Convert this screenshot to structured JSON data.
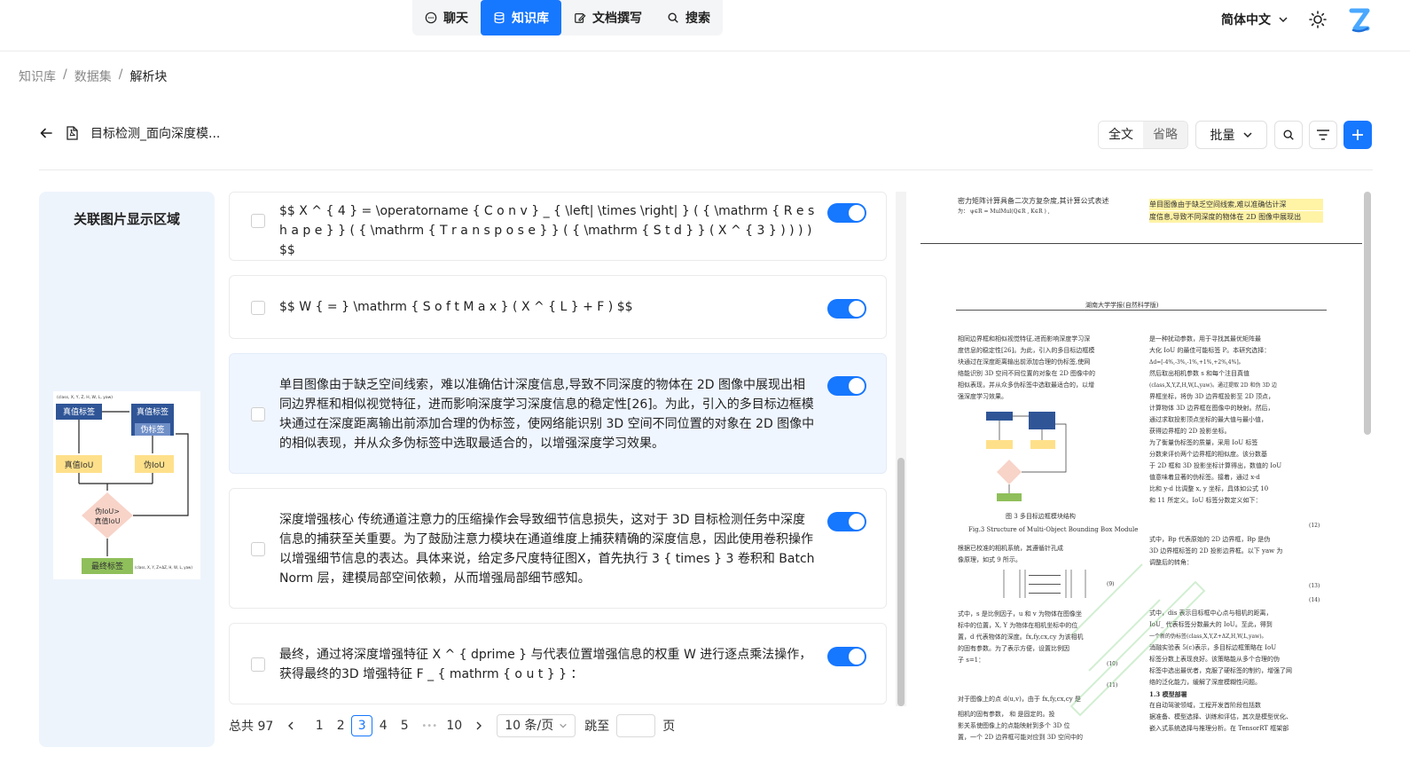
{
  "nav": {
    "items": [
      {
        "label": "聊天",
        "icon": "chat-icon",
        "active": false
      },
      {
        "label": "知识库",
        "icon": "database-icon",
        "active": true
      },
      {
        "label": "文档撰写",
        "icon": "edit-icon",
        "active": false
      },
      {
        "label": "搜索",
        "icon": "search-icon",
        "active": false
      }
    ],
    "language": "简体中文"
  },
  "breadcrumb": [
    "知识库",
    "数据集",
    "解析块"
  ],
  "document": {
    "title": "目标检测_面向深度模..."
  },
  "toolbar": {
    "view_full": "全文",
    "view_brief": "省略",
    "batch": "批量"
  },
  "left_panel": {
    "title": "关联图片显示区域",
    "flow": {
      "top_note": "(class, X, Y, Z, H, W, L, yaw)",
      "n1": "真值标签",
      "n2": "真值标签",
      "n2b": "伪标签",
      "n3": "真值IoU",
      "n4": "伪IoU",
      "n5": "伪IoU>",
      "n5b": "真值IoU",
      "n6": "最终标签",
      "bottom_note": "(class, X, Y, Z+ΔZ, H, W, L, yaw)"
    }
  },
  "chunks": [
    {
      "text": "$$ X ^ { 4 } = \\operatorname { C o n v } _ { \\left| \\times \\right| } ( { \\mathrm { R e s h a p e } } ( { \\mathrm { T r a n s p o s e } } ( { \\mathrm { S t d } } ( X ^ { 3 } ) ) ) ) $$",
      "enabled": true,
      "selected": false
    },
    {
      "text": "$$ W { = } \\mathrm { S o f t M a x } ( X ^ { L } + F ) $$",
      "enabled": true,
      "selected": false
    },
    {
      "text": "单目图像由于缺乏空间线索，难以准确估计深度信息,导致不同深度的物体在 2D 图像中展现出相同边界框和相似视觉特征，进而影响深度学习深度信息的稳定性[26]。为此，引入的多目标边框模块通过在深度距离输出前添加合理的伪标签，使网络能识别 3D 空间不同位置的对象在 2D 图像中的相似表现，并从众多伪标签中选取最适合的，以增强深度学习效果。",
      "enabled": true,
      "selected": true
    },
    {
      "text": "深度增强核心 传统通道注意力的压缩操作会导致细节信息损失，这对于 3D 目标检测任务中深度信息的捕获至关重要。为了鼓励注意力模块在通道维度上捕获精确的深度信息，因此使用卷积操作以增强细节信息的表达。具体来说，给定多尺度特征图X，首先执行 3 { times } 3 卷积和 BatchNorm 层，建模局部空间依赖，从而增强局部细节感知。",
      "enabled": true,
      "selected": false
    },
    {
      "text": "最终，通过将深度增强特征 X ^ { dprime } 与代表位置增强信息的权重 W 进行逐点乘法操作，获得最终的3D 增强特征 F _ { mathrm { o u t } } ：",
      "enabled": true,
      "selected": false
    }
  ],
  "pagination": {
    "total": "总共 97",
    "pages": [
      "1",
      "2",
      "3",
      "4",
      "5",
      "•••",
      "10"
    ],
    "current": "3",
    "page_size": "10 条/页",
    "jump_label": "跳至",
    "page_suffix": "页"
  },
  "pdf": {
    "top_left_1": "密力矩阵计算具备二次方复杂度,其计算公式表述",
    "top_left_2": "为：   ψ∈R = MulMul(Q∈R , K∈R  ) ,",
    "top_right_1": "单目图像由于缺乏空间线索,难以准确估计深",
    "top_right_2": "度信息,导致不同深度的物体在 2D 图像中展现出",
    "journal": "湖南大学学报(自然科学版)",
    "fig_caption_cn": "图 3  多目标边框模块结构",
    "fig_caption_en": "Fig.3  Structure of Multi-Object Bounding Box Module",
    "col1_lines": [
      "相同边界框和相似视觉特征,进而影响深度学习深",
      "度信息的稳定性[26]。为此，引入的多目标边框模",
      "块通过在深度距离输出前添加合理的伪标签,使网",
      "络能识别 3D 空间不同位置的对象在 2D 图像中的",
      "相似表现，并从众多伪标签中选取最适合的，以增",
      "强深度学习效果。"
    ],
    "col1b_lines": [
      "根据已校准的相机系统，其遵循针孔成",
      "像原理，如式 9 所示。",
      "式中，s 是比例因子，u 和 v 为物体在图像坐",
      "标中的位置，X, Y 为物体在相机坐标中的位",
      "置，d 代表物体的深度。fx,fy,cx,cy 为该相机",
      "的固有参数。为了表示方便，设置比例因",
      "子 s=1："
    ],
    "col2_lines": [
      "是一种扰动参数，用于寻找其最优矩阵最",
      "大化 IoU 的最佳可能标签 P。本研究选择：",
      "Δd=[-4%,-3%,-1%,+1%,+2%,4%]。",
      "然后取出相机参数 s 和每个注目真值",
      "(class,X,Y,Z,H,W,L,yaw)。通过提取 2D 和伪 3D 边",
      "界框坐标，将伪 3D 边界框投影至 2D 顶点，",
      "计算物体 3D 边界框在图像中的映射。然后，",
      "通过求取投影顶点坐标的最大值与最小值，",
      "获得边界框的 2D 投影坐标。",
      "为了衡量伪标签的质量，采用 IoU 标签",
      "分数来评价两个边界框的相似度。该分数基",
      "于 2D 框和 3D 投影坐标计算得出，数值的 IoU",
      "值意味着显著的伪标签。接着，通过 x-d",
      "比和 y-d 比调整 x, y 坐标，具体如公式 10",
      "和 11 所定义。IoU 标签分数定义如下："
    ],
    "col2b_lines": [
      "式中，Bp 代表原始的 2D 边界框，Bp 是伪",
      "3D 边界框标签的 2D 投影边界框。以下 yaw 为",
      "调整后的转角：",
      "式中，dis 表示目标框中心点与相机的距离，",
      "IoU_ 代表标签分数最大的 IoU。至此，得到",
      "一个新的伪标签(class,X,Y,Z+ΔZ,H,W,L,yaw)。",
      "消融实验表 5(c)表示，多目标边框策略在 IoU",
      "标签分数上表现良好。该策略能从多个合理的伪",
      "标签中选出最优者，克服了硬标签的制约，增强了网",
      "络的泛化能力，缓解了深度模糊性问题。",
      "1.3  模型部署",
      "在自动驾驶领域，工程开发首阶段包括数",
      "据准备、模型选择、训练和评估，其次是模型优化、",
      "嵌入式系统选择与推理分析。在 TensorRT 框架部"
    ],
    "col1c_lines": [
      "对于图像上的点 d(u,v)，由于 fx,fy,cx,cy 是",
      "相机的固有参数，      和      是固定的。投",
      "影关系使图像上的点能映射到多个 3D 位",
      "置，一个 2D 边界框可能对应到 3D 空间中的"
    ],
    "eq_nums": [
      "(9)",
      "(10)",
      "(11)",
      "(12)",
      "(13)",
      "(14)"
    ]
  }
}
